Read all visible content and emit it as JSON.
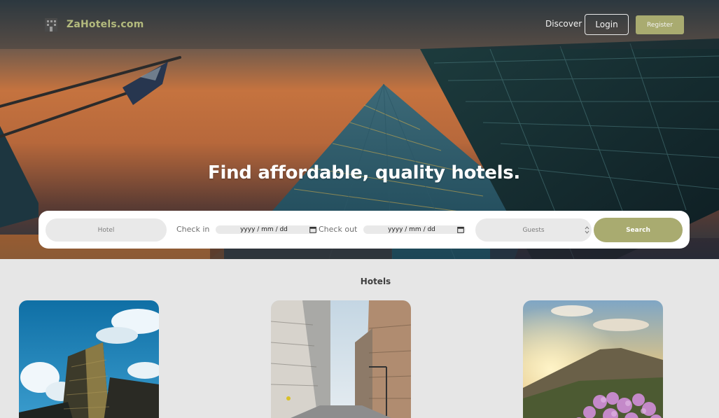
{
  "brand": {
    "name": "ZaHotels.com",
    "accent": "#a9ab70",
    "logo_text_color": "#b3ba7d"
  },
  "nav": {
    "discover": "Discover",
    "login": "Login",
    "register": "Register"
  },
  "hero": {
    "title": "Find affordable, quality hotels."
  },
  "search": {
    "hotel_placeholder": "Hotel",
    "check_in_label": "Check in",
    "check_in_value": "yyyy / mm / dd",
    "check_out_label": "Check out",
    "check_out_value": "yyyy / mm / dd",
    "guests_placeholder": "Guests",
    "search_label": "Search"
  },
  "hotels": {
    "title": "Hotels",
    "cards": [
      {
        "image": "glass-tower-blue-sky"
      },
      {
        "image": "city-street-buildings"
      },
      {
        "image": "mountain-sunset-flowers"
      }
    ]
  },
  "icons": [
    "building-icon",
    "calendar-icon",
    "calendar-icon",
    "spinner-arrows-icon"
  ]
}
